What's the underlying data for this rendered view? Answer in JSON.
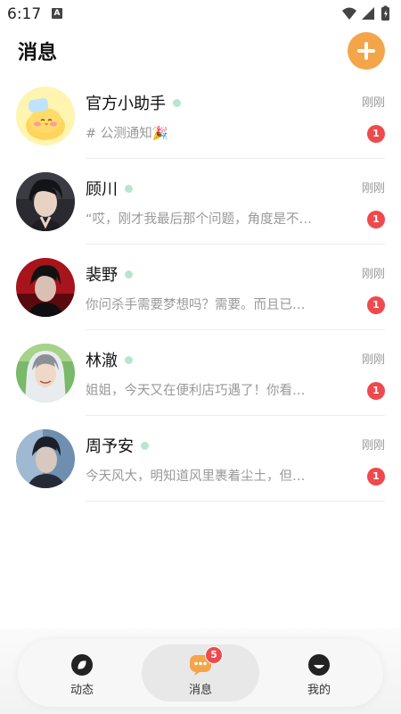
{
  "status_bar": {
    "time": "6:17",
    "notification_icon": "A"
  },
  "header": {
    "title": "消息",
    "add_icon": "plus-icon"
  },
  "conversations": [
    {
      "name": "官方小助手",
      "online": true,
      "time": "刚刚",
      "preview": "# 公测通知🎉",
      "unread": "1",
      "avatar": "cartoon-chick"
    },
    {
      "name": "顾川",
      "online": true,
      "time": "刚刚",
      "preview": "“哎，刚才我最后那个问题，角度是不…",
      "unread": "1",
      "avatar": "portrait"
    },
    {
      "name": "裴野",
      "online": true,
      "time": "刚刚",
      "preview": "你问杀手需要梦想吗？需要。而且已…",
      "unread": "1",
      "avatar": "portrait-red"
    },
    {
      "name": "林澈",
      "online": true,
      "time": "刚刚",
      "preview": "姐姐，今天又在便利店巧遇了！你看…",
      "unread": "1",
      "avatar": "portrait-green"
    },
    {
      "name": "周予安",
      "online": true,
      "time": "刚刚",
      "preview": "今天风大，明知道风里裹着尘土，但…",
      "unread": "1",
      "avatar": "portrait-blue"
    }
  ],
  "tabbar": {
    "tabs": [
      {
        "label": "动态",
        "icon": "compass-icon",
        "active": false
      },
      {
        "label": "消息",
        "icon": "chat-icon",
        "active": true,
        "badge": "5"
      },
      {
        "label": "我的",
        "icon": "profile-icon",
        "active": false
      }
    ]
  },
  "colors": {
    "accent": "#f4a54a",
    "badge": "#ee4a4e",
    "online": "#b8e6cc"
  }
}
